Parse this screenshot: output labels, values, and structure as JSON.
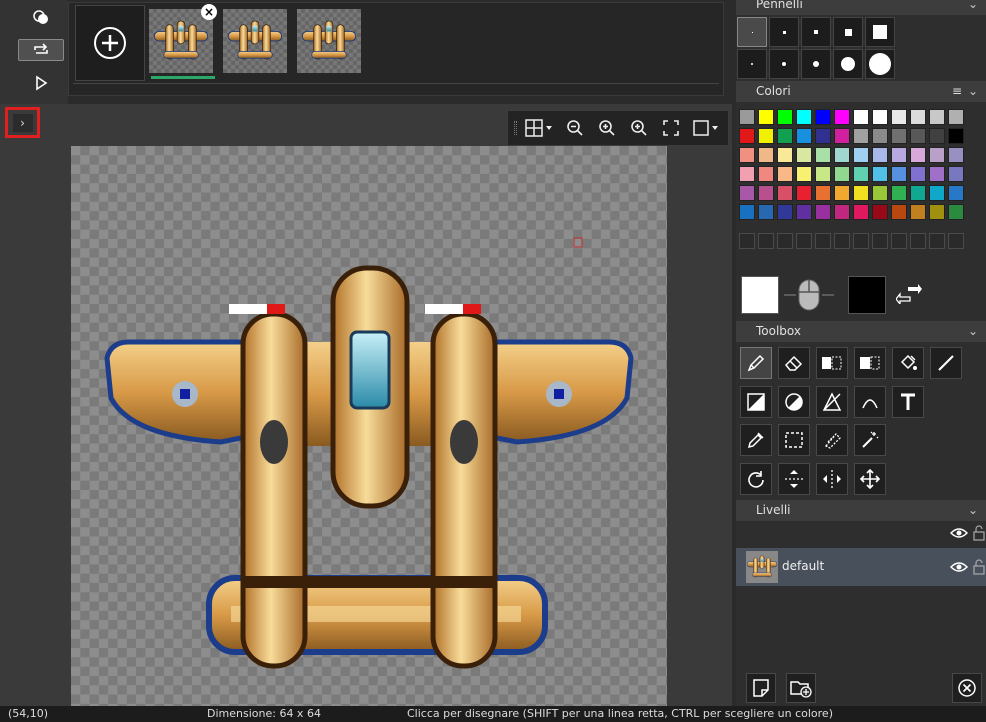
{
  "animation": {
    "frames": [
      {
        "selected": true,
        "has_close": true
      },
      {
        "selected": false,
        "has_close": false
      },
      {
        "selected": false,
        "has_close": false
      }
    ],
    "icons": [
      "onion-skin-icon",
      "loop-icon",
      "play-icon",
      "add-frame-icon"
    ]
  },
  "canvas_toolbar": {
    "icons": [
      "grid-icon",
      "zoom-out-icon",
      "zoom-in-icon",
      "zoom-in-alt-icon",
      "fullscreen-icon",
      "background-icon"
    ]
  },
  "panels": {
    "brushes": {
      "title": "Pennelli"
    },
    "colors": {
      "title": "Colori",
      "palette": [
        [
          "#9a9a9a",
          "#ffff00",
          "#00ff00",
          "#00ffff",
          "#0000ff",
          "#ff00ff",
          "#ffffff",
          "#ffffff",
          "#e8e8e8",
          "#dcdcdc",
          "#c8c8c8",
          "#b0b0b0"
        ],
        [
          "#e01818",
          "#f0f000",
          "#10a050",
          "#1890e0",
          "#303090",
          "#d020a0",
          "#a0a0a0",
          "#8a8a8a",
          "#707070",
          "#585858",
          "#404040",
          "#000000"
        ],
        [
          "#f09080",
          "#f0b888",
          "#f8e898",
          "#d8e8a0",
          "#a8e0a8",
          "#a0d8d0",
          "#a0d0f0",
          "#a8b8e8",
          "#b8a8e0",
          "#d8a8d8",
          "#b8a0c8",
          "#9890c0"
        ],
        [
          "#f0a0b0",
          "#f08880",
          "#f8b888",
          "#f8f070",
          "#c8e888",
          "#90d890",
          "#60d0b0",
          "#50c0e8",
          "#5890e0",
          "#8070d0",
          "#a070c8",
          "#7878c0"
        ],
        [
          "#a858a8",
          "#b85090",
          "#d85068",
          "#e82030",
          "#e87030",
          "#f0a830",
          "#f0e020",
          "#98c838",
          "#30b050",
          "#10a890",
          "#10a8c8",
          "#2878c8"
        ],
        [
          "#1870c0",
          "#2868b0",
          "#303898",
          "#6030a0",
          "#9830a0",
          "#c02880",
          "#e01860",
          "#980818",
          "#b84810",
          "#c08020",
          "#a09010",
          "#2a8a40"
        ]
      ],
      "primary_color": "#ffffff",
      "secondary_color": "#000000"
    },
    "toolbox": {
      "title": "Toolbox"
    },
    "layers": {
      "title": "Livelli",
      "items": [
        {
          "name": "default"
        }
      ]
    }
  },
  "status": {
    "coords": "(54,10)",
    "dimension": "Dimensione: 64 x 64",
    "hint": "Clicca per disegnare (SHIFT per una linea retta, CTRL per scegliere un colore)"
  }
}
